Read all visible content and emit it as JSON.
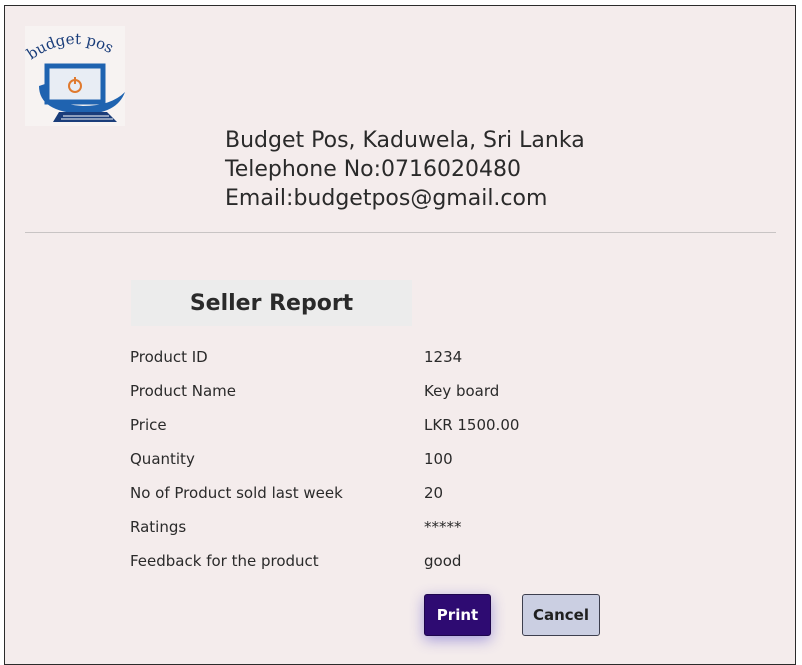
{
  "company": {
    "logo_text": "budget pos",
    "name": "Budget Pos, Kaduwela, Sri Lanka",
    "telephone": "Telephone No:0716020480",
    "email": "Email:budgetpos@gmail.com"
  },
  "report": {
    "title": "Seller Report",
    "rows": [
      {
        "label": "Product ID",
        "value": "1234"
      },
      {
        "label": "Product Name",
        "value": "Key board"
      },
      {
        "label": "Price",
        "value": "LKR 1500.00"
      },
      {
        "label": "Quantity",
        "value": "100"
      },
      {
        "label": "No of Product sold last week",
        "value": "20"
      },
      {
        "label": "Ratings",
        "value": "*****"
      },
      {
        "label": "Feedback for the product",
        "value": "good"
      }
    ]
  },
  "buttons": {
    "print_label": "Print",
    "cancel_label": "Cancel"
  },
  "colors": {
    "background": "#f4ecec",
    "print_button": "#2e0b72",
    "cancel_button": "#cbcfe2",
    "logo_blue": "#1f63b0",
    "logo_accent": "#e07a2e"
  }
}
